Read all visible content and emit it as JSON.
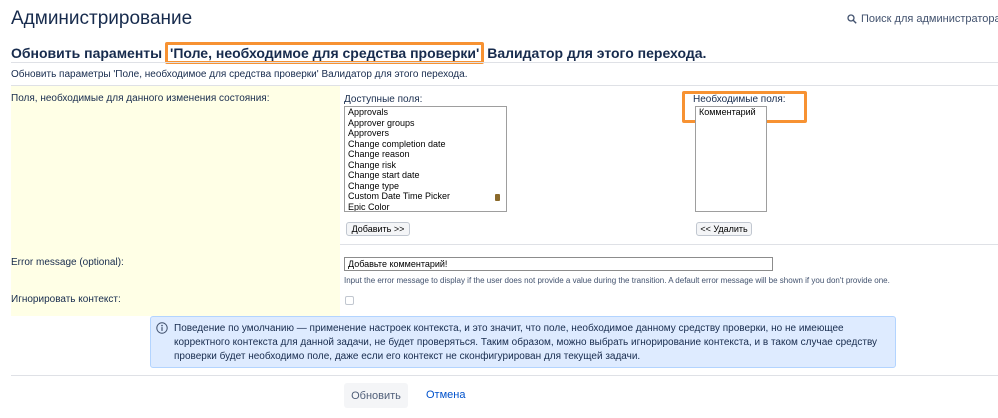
{
  "header": {
    "title": "Администрирование",
    "search_label": "Поиск для администратора"
  },
  "subtitle": {
    "prefix": "Обновить параменты ",
    "highlighted": "'Поле, необходимое для средства проверки'",
    "suffix": " Валидатор для этого перехода."
  },
  "description": "Обновить параметры 'Поле, необходимое для средства проверки' Валидатор для этого перехода.",
  "fields_row": {
    "label": "Поля, необходимые для данного изменения состояния:",
    "available_label": "Доступные поля:",
    "available_items": [
      "Approvals",
      "Approver groups",
      "Approvers",
      "Change completion date",
      "Change reason",
      "Change risk",
      "Change start date",
      "Change type",
      "Custom Date Time Picker",
      "Epic Color"
    ],
    "add_button": "Добавить >>",
    "required_label": "Необходимые поля:",
    "required_items": [
      "Комментарий"
    ],
    "remove_button": "<< Удалить"
  },
  "error_row": {
    "label": "Error message (optional):",
    "value": "Добавьте комментарий!",
    "hint": "Input the error message to display if the user does not provide a value during the transition. A default error message will be shown if you don't provide one."
  },
  "context_row": {
    "label": "Игнорировать контекст:",
    "checked": false
  },
  "info": {
    "text": "Поведение по умолчанию — применение настроек контекста, и это значит, что поле, необходимое данному средству проверки, но не имеющее корректного контекста для данной задачи, не будет проверяться. Таким образом, можно выбрать игнорирование контекста, и в таком случае средству проверки будет необходимо поле, даже если его контекст не сконфигурирован для текущей задачи."
  },
  "actions": {
    "update_label": "Обновить",
    "cancel_label": "Отмена"
  },
  "colors": {
    "highlight": "#f79232",
    "label_bg": "#ffffe6",
    "info_bg": "#deebff",
    "link": "#0052cc"
  }
}
